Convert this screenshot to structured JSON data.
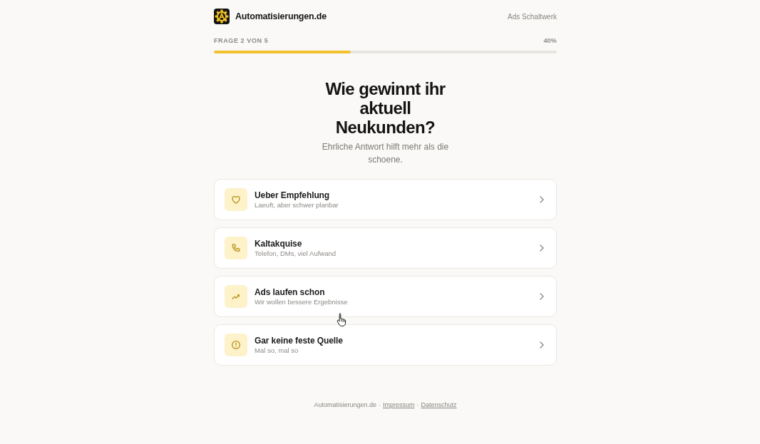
{
  "header": {
    "brand": "Automatisierungen.de",
    "tagline": "Ads Schaltwerk"
  },
  "progress": {
    "label": "FRAGE 2 VON 5",
    "percent": "40%",
    "level": 0.4
  },
  "question": {
    "title": "Wie gewinnt ihr aktuell Neukunden?",
    "subtitle": "Ehrliche Antwort hilft mehr als die schoene."
  },
  "options": [
    {
      "title": "Ueber Empfehlung",
      "subtitle": "Laeuft, aber schwer planbar"
    },
    {
      "title": "Kaltakquise",
      "subtitle": "Telefon, DMs, viel Aufwand"
    },
    {
      "title": "Ads laufen schon",
      "subtitle": "Wir wollen bessere Ergebnisse"
    },
    {
      "title": "Gar keine feste Quelle",
      "subtitle": "Mal so, mal so"
    }
  ],
  "footer": [
    {
      "kind": "text",
      "label": "Automatisierungen.de"
    },
    {
      "kind": "separator",
      "label": "·"
    },
    {
      "kind": "link",
      "label": "Impressum"
    },
    {
      "kind": "separator",
      "label": "·"
    },
    {
      "kind": "link",
      "label": "Datenschutz"
    }
  ]
}
